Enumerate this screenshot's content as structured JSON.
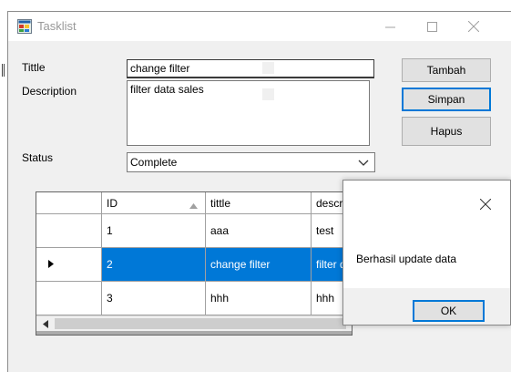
{
  "window": {
    "title": "Tasklist"
  },
  "form": {
    "tittle_label": "Tittle",
    "description_label": "Description",
    "status_label": "Status",
    "tittle_value": "change filter",
    "description_value": "filter data sales",
    "status_value": "Complete"
  },
  "buttons": {
    "tambah": "Tambah",
    "simpan": "Simpan",
    "hapus": "Hapus"
  },
  "grid": {
    "headers": [
      "ID",
      "tittle",
      "descrip"
    ],
    "rows": [
      {
        "id": "1",
        "tittle": "aaa",
        "description": "test"
      },
      {
        "id": "2",
        "tittle": "change filter",
        "description": "filter da"
      },
      {
        "id": "3",
        "tittle": "hhh",
        "description": "hhh"
      }
    ],
    "selected_row": 1
  },
  "dialog": {
    "message": "Berhasil update data",
    "ok_label": "OK"
  },
  "colors": {
    "accent": "#0078d7",
    "window_bg": "#f0f0f0"
  },
  "icons": [
    "app-window-icon",
    "minimize-icon",
    "maximize-icon",
    "close-icon",
    "chevron-down-icon",
    "sort-up-icon",
    "row-pointer-icon",
    "scroll-left-icon"
  ]
}
